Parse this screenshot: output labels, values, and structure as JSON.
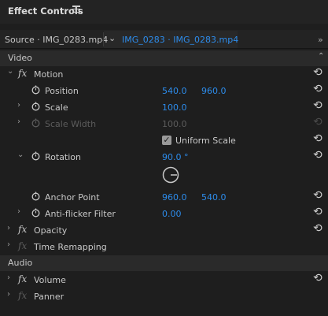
{
  "panel": {
    "title": "Effect Controls"
  },
  "tabs": {
    "source": "Source · IMG_0283.mp4",
    "sequence": "IMG_0283 · IMG_0283.mp4",
    "overflow": "»"
  },
  "sections": {
    "video": "Video",
    "audio": "Audio"
  },
  "motion": {
    "label": "Motion",
    "position": {
      "label": "Position",
      "x": "540.0",
      "y": "960.0"
    },
    "scale": {
      "label": "Scale",
      "value": "100.0"
    },
    "scale_width": {
      "label": "Scale Width",
      "value": "100.0"
    },
    "uniform_scale": {
      "label": "Uniform Scale",
      "checked": true
    },
    "rotation": {
      "label": "Rotation",
      "value": "90.0 °"
    },
    "anchor_point": {
      "label": "Anchor Point",
      "x": "960.0",
      "y": "540.0"
    },
    "anti_flicker": {
      "label": "Anti-flicker Filter",
      "value": "0.00"
    }
  },
  "effects": {
    "opacity": "Opacity",
    "time_remapping": "Time Remapping",
    "volume": "Volume",
    "panner": "Panner"
  },
  "icons": {
    "reset": "reset-icon",
    "stopwatch": "stopwatch-icon",
    "fx": "fx-icon",
    "menu": "hamburger-menu-icon"
  },
  "colors": {
    "accent": "#2d8ceb",
    "background": "#1e1e1e",
    "section": "#2a2a2a"
  }
}
